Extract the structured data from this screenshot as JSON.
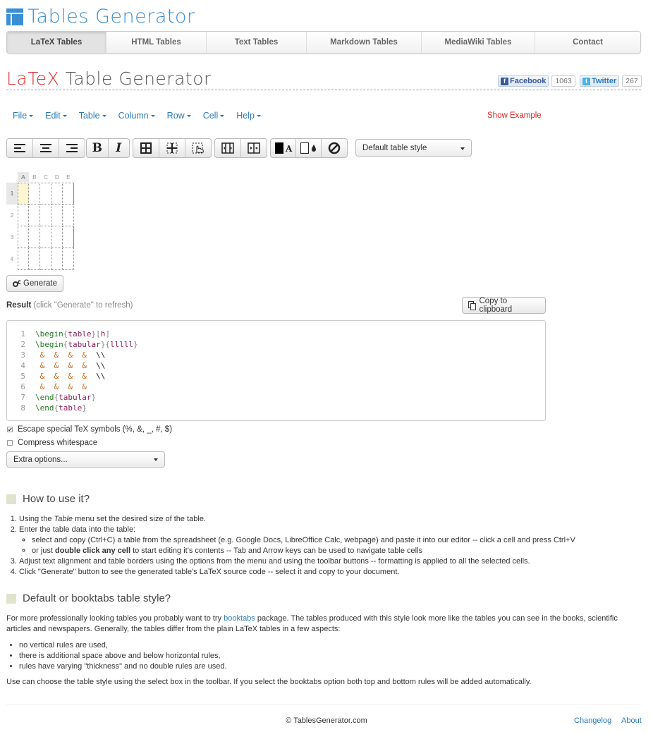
{
  "logo": {
    "text": "Tables Generator",
    "icon": "table-logo-icon"
  },
  "nav": {
    "items": [
      {
        "label": "LaTeX Tables",
        "active": true
      },
      {
        "label": "HTML Tables"
      },
      {
        "label": "Text Tables"
      },
      {
        "label": "Markdown Tables"
      },
      {
        "label": "MediaWiki Tables"
      },
      {
        "label": "Contact"
      }
    ]
  },
  "heading": {
    "accent": "LaTeX",
    "rest": " Table Generator"
  },
  "social": {
    "facebook": {
      "label": "Facebook",
      "count": "1063"
    },
    "twitter": {
      "label": "Twitter",
      "count": "267"
    }
  },
  "menu": {
    "items": [
      "File",
      "Edit",
      "Table",
      "Column",
      "Row",
      "Cell",
      "Help"
    ],
    "show_example": "Show Example"
  },
  "toolbar": {
    "style_select": "Default table style",
    "icons": [
      "align-left-icon",
      "align-center-icon",
      "align-right-icon",
      "bold-icon",
      "italic-icon",
      "all-borders-icon",
      "inner-borders-icon",
      "border-hand-icon",
      "merge-cells-icon",
      "split-cells-icon",
      "text-color-icon",
      "background-color-icon",
      "clear-format-icon"
    ]
  },
  "grid": {
    "columns": [
      "A",
      "B",
      "C",
      "D",
      "E"
    ],
    "rows": [
      "1",
      "2",
      "3",
      "4"
    ]
  },
  "generate_label": "Generate",
  "result": {
    "label": "Result",
    "hint": "(click \"Generate\" to refresh)",
    "copy_label": "Copy to clipboard"
  },
  "code": {
    "line_numbers": [
      "1",
      "2",
      "3",
      "4",
      "5",
      "6",
      "7",
      "8"
    ]
  },
  "options": {
    "escape": {
      "label": "Escape special TeX symbols (%, &, _, #, $)",
      "checked": true
    },
    "compress": {
      "label": "Compress whitespace",
      "checked": false
    },
    "extra": "Extra options..."
  },
  "howto": {
    "title": "How to use it?",
    "step1_pre": "Using the ",
    "step1_em": "Table",
    "step1_post": " menu set the desired size of the table.",
    "step2": "Enter the table data into the table:",
    "step2a": "select and copy (Ctrl+C) a table from the spreadsheet (e.g. Google Docs, LibreOffice Calc, webpage) and paste it into our editor -- click a cell and press Ctrl+V",
    "step2b_pre": "or just ",
    "step2b_bold": "double click any cell",
    "step2b_post": " to start editing it's contents -- Tab and Arrow keys can be used to navigate table cells",
    "step3": "Adjust text alignment and table borders using the options from the menu and using the toolbar buttons -- formatting is applied to all the selected cells.",
    "step4": "Click \"Generate\" button to see the generated table's LaTeX source code -- select it and copy to your document."
  },
  "booktabs": {
    "title": "Default or booktabs table style?",
    "p1_pre": "For more professionally looking tables you probably want to try ",
    "p1_link": "booktabs",
    "p1_post": " package. The tables produced with this style look more like the tables you can see in the books, scientific articles and newspapers. Generally, the tables differ from the plain LaTeX tables in a few aspects:",
    "bullets": [
      "no vertical rules are used,",
      "there is additional space above and below horizontal rules,",
      "rules have varying \"thickness\" and no double rules are used."
    ],
    "p2": "Use can choose the table style using the select box in the toolbar. If you select the booktabs option both top and bottom rules will be added automatically."
  },
  "footer": {
    "copyright": "© TablesGenerator.com",
    "changelog": "Changelog",
    "about": "About"
  },
  "colors": {
    "accent": "#3a8fd4",
    "link": "#2a7ab8",
    "red": "#d33"
  }
}
